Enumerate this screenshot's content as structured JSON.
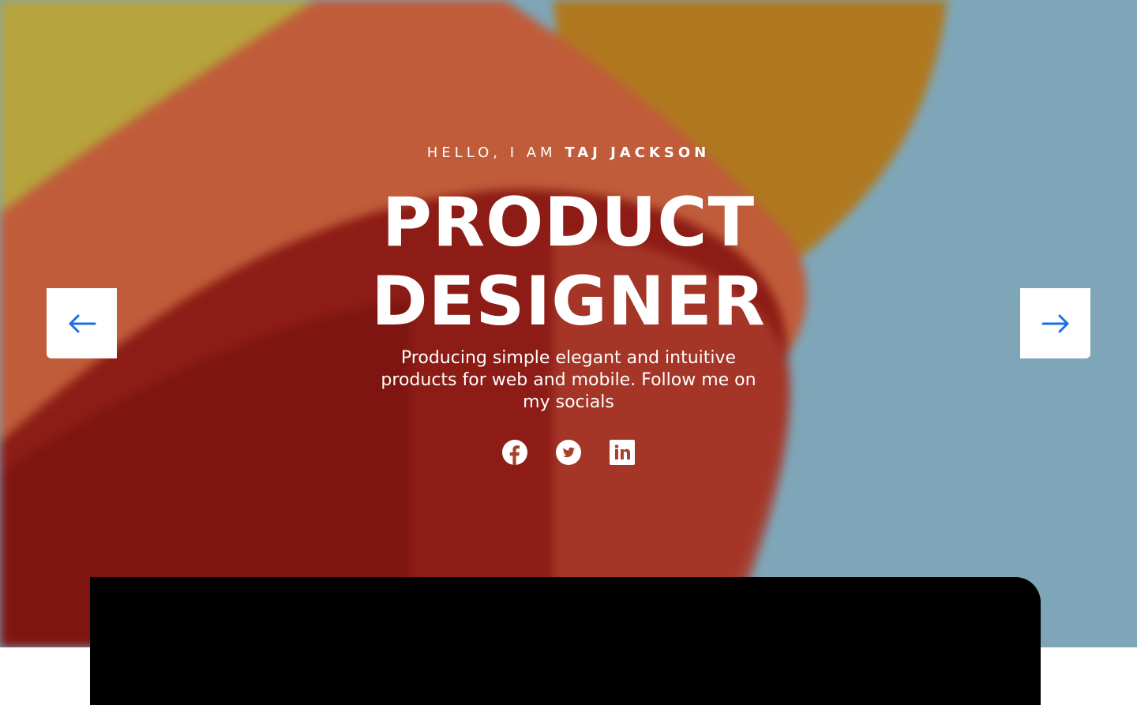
{
  "hero": {
    "greeting_prefix": "HELLO, I AM",
    "greeting_name": "TAJ JACKSON",
    "title_line1": "PRODUCT",
    "title_line2": "DESIGNER",
    "subtitle": "Producing simple elegant and intuitive products for web and mobile. Follow me on my socials"
  },
  "socials": [
    {
      "icon": "facebook-icon"
    },
    {
      "icon": "twitter-icon"
    },
    {
      "icon": "linkedin-icon"
    }
  ],
  "nav": {
    "prev_icon": "arrow-left-icon",
    "next_icon": "arrow-right-icon",
    "accent_color": "#1a6ee8"
  },
  "colors": {
    "yellow": "#b8a33a",
    "orange": "#c05a35",
    "red": "#8a1a14",
    "gold": "#b07a1e",
    "blue": "#7ea6b8",
    "video_block": "#000000"
  }
}
